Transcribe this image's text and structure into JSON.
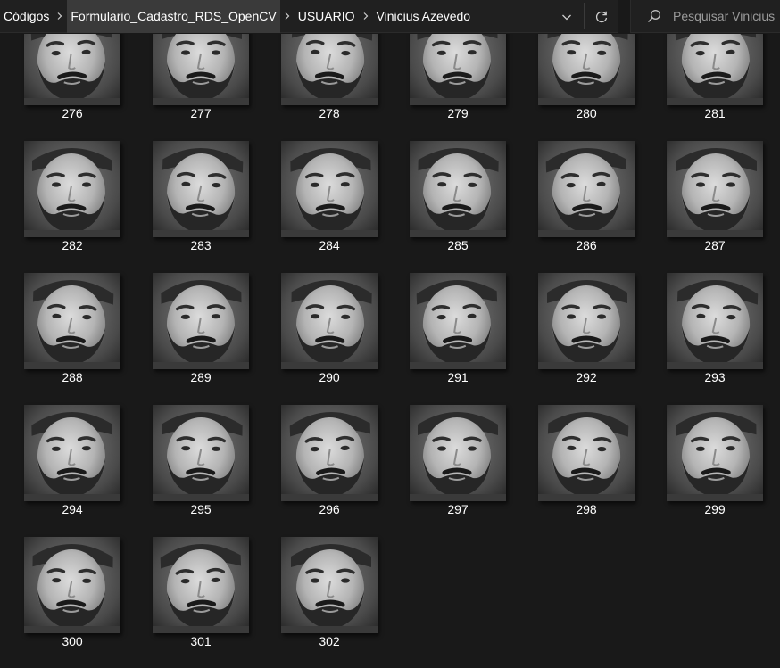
{
  "address_bar": {
    "breadcrumbs": [
      {
        "label": "Códigos",
        "active": false
      },
      {
        "label": "Formulario_Cadastro_RDS_OpenCV",
        "active": true
      },
      {
        "label": "USUARIO",
        "active": false
      },
      {
        "label": "Vinicius Azevedo",
        "active": false
      }
    ],
    "dropdown_icon": "chevron-down-icon",
    "refresh_icon": "refresh-icon"
  },
  "search": {
    "placeholder": "Pesquisar Vinicius",
    "icon": "search-icon"
  },
  "files": [
    {
      "name": "276"
    },
    {
      "name": "277"
    },
    {
      "name": "278"
    },
    {
      "name": "279"
    },
    {
      "name": "280"
    },
    {
      "name": "281"
    },
    {
      "name": "282"
    },
    {
      "name": "283"
    },
    {
      "name": "284"
    },
    {
      "name": "285"
    },
    {
      "name": "286"
    },
    {
      "name": "287"
    },
    {
      "name": "288"
    },
    {
      "name": "289"
    },
    {
      "name": "290"
    },
    {
      "name": "291"
    },
    {
      "name": "292"
    },
    {
      "name": "293"
    },
    {
      "name": "294"
    },
    {
      "name": "295"
    },
    {
      "name": "296"
    },
    {
      "name": "297"
    },
    {
      "name": "298"
    },
    {
      "name": "299"
    },
    {
      "name": "300"
    },
    {
      "name": "301"
    },
    {
      "name": "302"
    }
  ],
  "colors": {
    "window_bg": "#191919",
    "bar_bg": "#202020",
    "active_crumb_bg": "#3a3a3a",
    "text": "#ffffff"
  }
}
